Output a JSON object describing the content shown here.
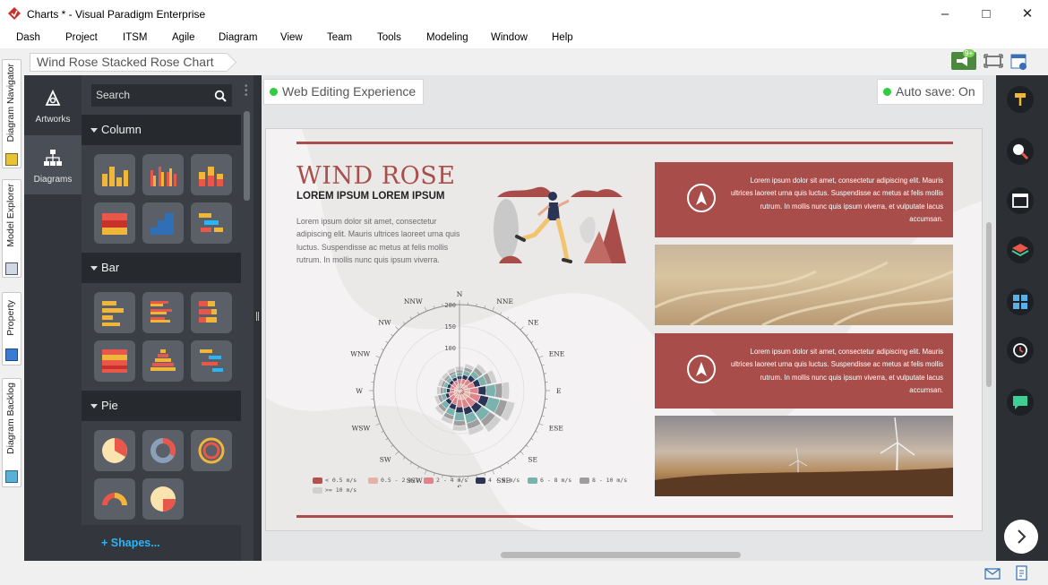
{
  "window": {
    "title": "Charts * - Visual Paradigm Enterprise"
  },
  "menu": [
    "Dash",
    "Project",
    "ITSM",
    "Agile",
    "Diagram",
    "View",
    "Team",
    "Tools",
    "Modeling",
    "Window",
    "Help"
  ],
  "left_tabs": [
    "Diagram Navigator",
    "Model Explorer",
    "Property",
    "Diagram Backlog"
  ],
  "breadcrumb": "Wind Rose Stacked Rose Chart",
  "notify_badge": "9+",
  "categories": {
    "artworks": "Artworks",
    "diagrams": "Diagrams"
  },
  "search": {
    "placeholder": "Search"
  },
  "groups": {
    "column": "Column",
    "bar": "Bar",
    "pie": "Pie"
  },
  "shapes_link": "+ Shapes...",
  "canvas": {
    "web_editing": "Web Editing Experience",
    "autosave": "Auto save: On"
  },
  "infographic": {
    "title": "WIND ROSE",
    "subtitle": "LOREM IPSUM LOREM IPSUM",
    "body": "Lorem ipsum dolor sit amet, consectetur adipiscing elit. Mauris ultrices laoreet urna quis luctus. Suspendisse ac metus at felis mollis rutrum. In mollis nunc quis ipsum viverra.",
    "box1": "Lorem ipsum dolor sit amet, consectetur adipiscing elit. Mauris ultrices laoreet urna quis luctus. Suspendisse ac metus at felis mollis rutrum. In mollis nunc quis ipsum viverra, et vulputate lacus accumsan.",
    "box2": "Lorem ipsum dolor sit amet, consectetur adipiscing elit. Mauris ultrices laoreet urna quis luctus. Suspendisse ac metus at felis mollis rutrum. In mollis nunc quis ipsum viverra, et vulputate lacus accumsan."
  },
  "chart_data": {
    "type": "polar-stacked-bar",
    "directions": [
      "N",
      "NNE",
      "NE",
      "ENE",
      "E",
      "ESE",
      "SE",
      "SSE",
      "S",
      "SSW",
      "SW",
      "WSW",
      "W",
      "WNW",
      "NW",
      "NNW"
    ],
    "radial_ticks": [
      100,
      150,
      200
    ],
    "rmax": 200,
    "series": [
      {
        "name": "< 0.5 m/s",
        "color": "#b5504c",
        "values": [
          8,
          8,
          9,
          10,
          12,
          13,
          12,
          11,
          10,
          9,
          8,
          7,
          6,
          6,
          6,
          7
        ]
      },
      {
        "name": "0.5 - 2 m/s",
        "color": "#e5b3a6",
        "values": [
          8,
          8,
          9,
          10,
          12,
          13,
          12,
          11,
          10,
          9,
          8,
          7,
          6,
          6,
          6,
          7
        ]
      },
      {
        "name": "2 - 4 m/s",
        "color": "#e0838a",
        "values": [
          10,
          12,
          14,
          16,
          20,
          24,
          22,
          20,
          18,
          16,
          14,
          12,
          10,
          10,
          10,
          10
        ]
      },
      {
        "name": "4 - 6 m/s",
        "color": "#2a3556",
        "values": [
          8,
          10,
          12,
          14,
          18,
          20,
          18,
          16,
          14,
          12,
          10,
          8,
          8,
          8,
          8,
          8
        ]
      },
      {
        "name": "6 - 8 m/s",
        "color": "#7ab3ad",
        "values": [
          8,
          10,
          12,
          15,
          22,
          26,
          22,
          20,
          18,
          14,
          12,
          10,
          8,
          8,
          8,
          8
        ]
      },
      {
        "name": "8 - 10 m/s",
        "color": "#9e9e9e",
        "values": [
          6,
          8,
          10,
          12,
          16,
          18,
          16,
          14,
          12,
          10,
          9,
          8,
          7,
          6,
          6,
          6
        ]
      },
      {
        "name": ">= 10 m/s",
        "color": "#cfcfcf",
        "values": [
          8,
          8,
          10,
          12,
          16,
          18,
          16,
          14,
          12,
          10,
          9,
          8,
          8,
          8,
          8,
          8
        ]
      }
    ]
  }
}
